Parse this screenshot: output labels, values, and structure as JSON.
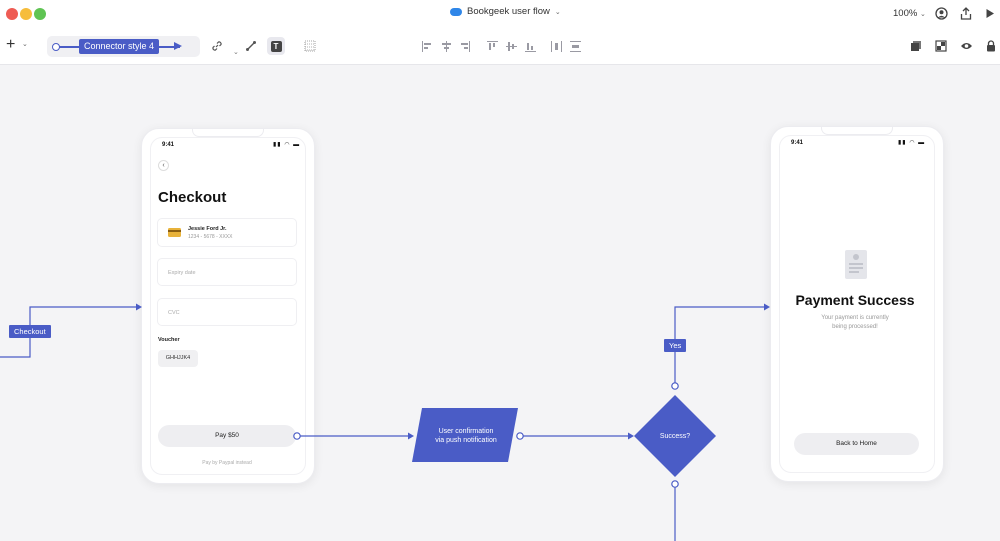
{
  "titlebar": {
    "doc_title": "Bookgeek user flow",
    "zoom": "100%"
  },
  "toolbar": {
    "connector_style": "Connector style 4",
    "accent_color": "#4a5cc6"
  },
  "checkout_screen": {
    "time": "9:41",
    "title": "Checkout",
    "card_name": "Jessie Ford Jr.",
    "card_number": "1234 - 5678 - XXXX",
    "expiry_placeholder": "Expiry date",
    "cvc_placeholder": "CVC",
    "voucher_label": "Voucher",
    "voucher_code": "GHHJJK4",
    "pay_button": "Pay $50",
    "paypal_link": "Pay by Paypal instead"
  },
  "success_screen": {
    "time": "9:41",
    "title": "Payment Success",
    "subtitle_line1": "Your payment is currently",
    "subtitle_line2": "being processed!",
    "home_button": "Back to Home"
  },
  "flow": {
    "checkout_tag": "Checkout",
    "process_line1": "User confirmation",
    "process_line2": "via push notification",
    "decision": "Success?",
    "yes_tag": "Yes"
  },
  "icons": [
    "cloud-icon",
    "user-icon",
    "share-icon",
    "play-icon",
    "plus-icon",
    "link-icon",
    "pen-icon",
    "text-icon",
    "pattern-icon",
    "align-icons",
    "layers-icon",
    "fit-icon",
    "preview-icon",
    "lock-icon",
    "receipt-icon"
  ]
}
